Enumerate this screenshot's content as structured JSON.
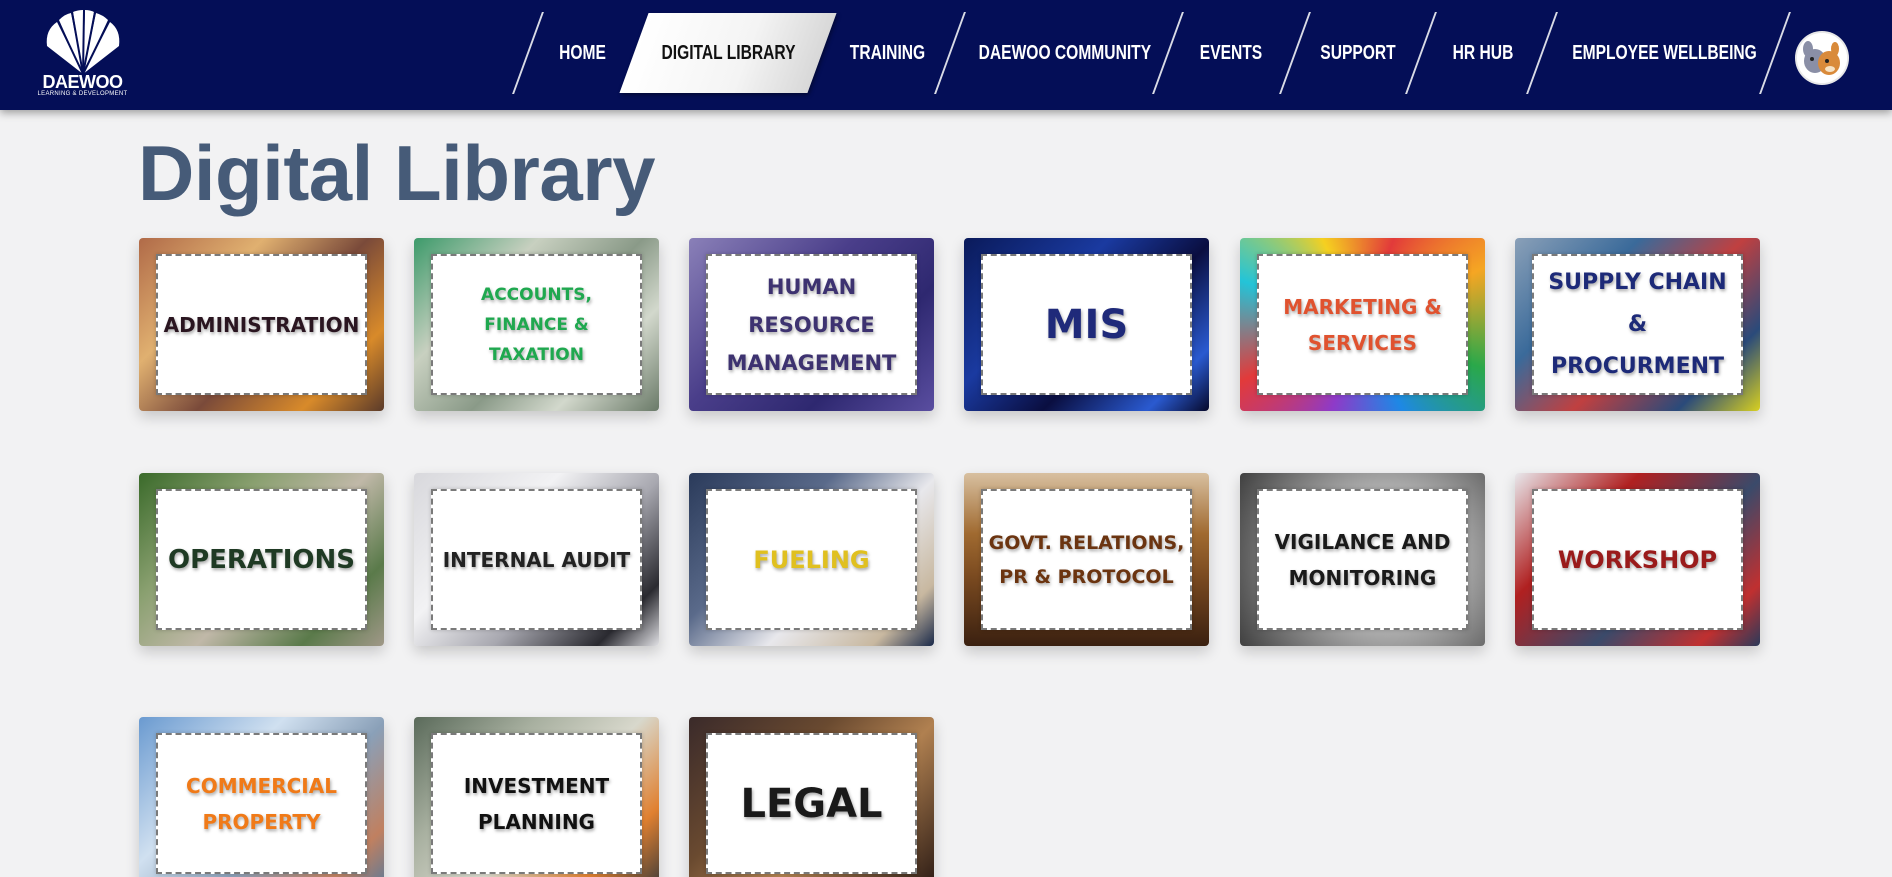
{
  "header": {
    "logo_text": "DAEWOO",
    "logo_subtext": "LEARNING & DEVELOPMENT",
    "nav": [
      {
        "label": "HOME"
      },
      {
        "label": "DIGITAL LIBRARY"
      },
      {
        "label": "TRAINING"
      },
      {
        "label": "DAEWOO COMMUNITY"
      },
      {
        "label": "EVENTS"
      },
      {
        "label": "SUPPORT"
      },
      {
        "label": "HR HUB"
      },
      {
        "label": "EMPLOYEE WELLBEING"
      }
    ],
    "active_nav": "DIGITAL LIBRARY",
    "bar_color": "#040e57"
  },
  "page": {
    "title": "Digital Library"
  },
  "categories": [
    {
      "label": "ADMINISTRATION",
      "color": "#2a1520"
    },
    {
      "label": "ACCOUNTS, FINANCE & TAXATION",
      "color": "#1fa84f"
    },
    {
      "label": "HUMAN RESOURCE MANAGEMENT",
      "color": "#3d3270"
    },
    {
      "label": "MIS",
      "color": "#1f2a7a"
    },
    {
      "label": "MARKETING & SERVICES",
      "color": "#e0522f"
    },
    {
      "label": "SUPPLY CHAIN & PROCURMENT",
      "color": "#1d2a78"
    },
    {
      "label": "OPERATIONS",
      "color": "#1f3a24"
    },
    {
      "label": "INTERNAL AUDIT",
      "color": "#222222"
    },
    {
      "label": "FUELING",
      "color": "#e0c020"
    },
    {
      "label": "GOVT. RELATIONS, PR & PROTOCOL",
      "color": "#6b3410"
    },
    {
      "label": "VIGILANCE AND MONITORING",
      "color": "#1a1a1a"
    },
    {
      "label": "WORKSHOP",
      "color": "#9a1b1b"
    },
    {
      "label": "COMMERCIAL PROPERTY",
      "color": "#f07a18"
    },
    {
      "label": "INVESTMENT PLANNING",
      "color": "#111111"
    },
    {
      "label": "LEGAL",
      "color": "#1a1a1a"
    }
  ]
}
